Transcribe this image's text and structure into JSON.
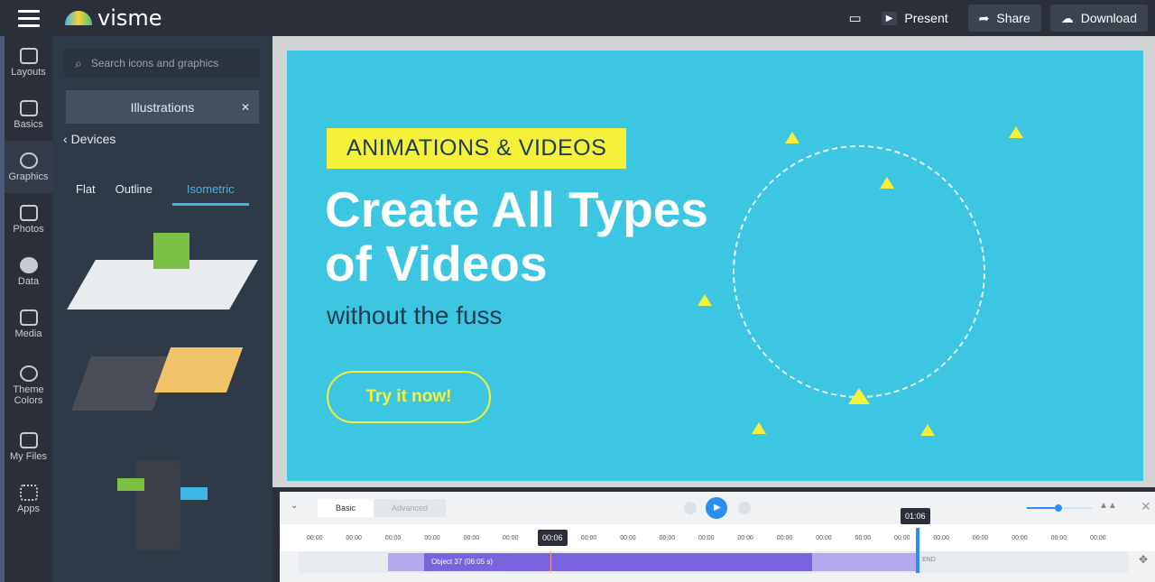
{
  "header": {
    "brand": "visme",
    "present": "Present",
    "share": "Share",
    "download": "Download"
  },
  "rail": [
    {
      "label": "Layouts"
    },
    {
      "label": "Basics"
    },
    {
      "label": "Graphics"
    },
    {
      "label": "Photos"
    },
    {
      "label": "Data"
    },
    {
      "label": "Media"
    },
    {
      "label": "Theme Colors"
    },
    {
      "label": "My Files"
    },
    {
      "label": "Apps"
    }
  ],
  "panel": {
    "search_placeholder": "Search icons and graphics",
    "category": "Illustrations",
    "back": "Devices",
    "tabs": [
      "Flat",
      "Outline",
      "Isometric"
    ]
  },
  "slide": {
    "pill": "ANIMATIONS & VIDEOS",
    "title": "Create All Types of Videos",
    "subtitle": "without the fuss",
    "cta": "Try it now!"
  },
  "timeline": {
    "tab_basic": "Basic",
    "tab_advanced": "Advanced",
    "end_time": "01:06",
    "current_time": "00:06",
    "ticks": [
      "00:00",
      "00:00",
      "00:00",
      "00:00",
      "00:00",
      "00:00",
      "00:00",
      "00:00",
      "00:00",
      "00:00",
      "00:00",
      "00:00",
      "00:00",
      "00:00",
      "00:00",
      "00:00",
      "00:00",
      "00:00",
      "00:00",
      "00:00",
      "00:00"
    ],
    "object_label": "Object 37 (06:05 s)",
    "end_label": "END"
  }
}
